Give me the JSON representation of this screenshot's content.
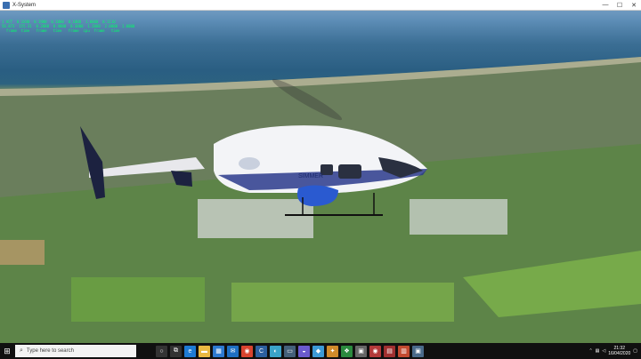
{
  "window": {
    "title": "X-System",
    "minimize": "—",
    "maximize": "☐",
    "close": "✕"
  },
  "hud": {
    "line1": "1 ACT  0.1640  0.1900  0.1000  0.1000  1.0000  0.1110",
    "line2": "56.873  155.31  0.2000  0.4000  0.3000  1.2000  2.0000  1.0000",
    "line3": "  frame  time   frame   time   frame  cpu  frame   time"
  },
  "helicopter": {
    "livery": "SIMMER"
  },
  "taskbar": {
    "start_icon": "windows-icon",
    "search_placeholder": "Type here to search",
    "icons": [
      {
        "name": "cortana-icon",
        "glyph": "○",
        "color": "#333333"
      },
      {
        "name": "task-view-icon",
        "glyph": "⧉",
        "color": "#333333"
      },
      {
        "name": "edge-icon",
        "glyph": "e",
        "color": "#1e7bd4"
      },
      {
        "name": "file-explorer-icon",
        "glyph": "▬",
        "color": "#e9b842"
      },
      {
        "name": "store-icon",
        "glyph": "▦",
        "color": "#2d7ad1"
      },
      {
        "name": "mail-icon",
        "glyph": "✉",
        "color": "#1e6fc2"
      },
      {
        "name": "chrome-icon",
        "glyph": "◉",
        "color": "#d9442f"
      },
      {
        "name": "app-icon-1",
        "glyph": "C",
        "color": "#2c5f9e"
      },
      {
        "name": "app-icon-2",
        "glyph": "◐",
        "color": "#3aa3c9"
      },
      {
        "name": "app-icon-3",
        "glyph": "▭",
        "color": "#44607a"
      },
      {
        "name": "app-icon-4",
        "glyph": "◒",
        "color": "#6a5acd"
      },
      {
        "name": "app-icon-5",
        "glyph": "◆",
        "color": "#3c9ad6"
      },
      {
        "name": "app-icon-6",
        "glyph": "✦",
        "color": "#d08a2a"
      },
      {
        "name": "app-icon-7",
        "glyph": "❖",
        "color": "#2b8a3e"
      },
      {
        "name": "app-icon-8",
        "glyph": "▣",
        "color": "#666666"
      },
      {
        "name": "app-icon-9",
        "glyph": "◉",
        "color": "#b33a3a"
      },
      {
        "name": "app-icon-10",
        "glyph": "▤",
        "color": "#a03030"
      },
      {
        "name": "app-icon-11",
        "glyph": "▥",
        "color": "#c24a30"
      },
      {
        "name": "xplane-taskbar-icon",
        "glyph": "▣",
        "color": "#4a6a8a"
      }
    ],
    "time": "21:32",
    "date": "16/04/2020"
  }
}
